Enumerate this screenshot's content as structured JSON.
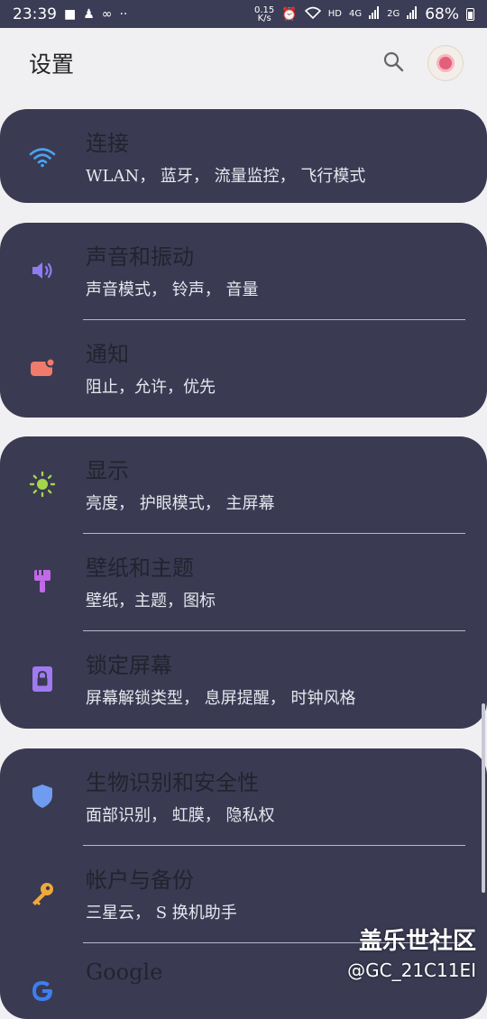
{
  "status_bar": {
    "time": "23:39",
    "speed_top": "0.15",
    "speed_bottom": "K/s",
    "hd": "HD",
    "net1": "4G",
    "net2": "2G",
    "battery": "68%"
  },
  "header": {
    "title": "设置"
  },
  "groups": [
    {
      "items": [
        {
          "title": "连接",
          "subtitle": "WLAN， 蓝牙， 流量监控， 飞行模式",
          "icon": "wifi-icon",
          "color": "#4aa3f0"
        }
      ]
    },
    {
      "items": [
        {
          "title": "声音和振动",
          "subtitle": "声音模式， 铃声， 音量",
          "icon": "volume-icon",
          "color": "#8f7cf0"
        },
        {
          "title": "通知",
          "subtitle": "阻止，允许，优先",
          "icon": "notification-icon",
          "color": "#f07a6b"
        }
      ]
    },
    {
      "items": [
        {
          "title": "显示",
          "subtitle": "亮度， 护眼模式， 主屏幕",
          "icon": "brightness-icon",
          "color": "#a4d64a"
        },
        {
          "title": "壁纸和主题",
          "subtitle": "壁纸，主题，图标",
          "icon": "brush-icon",
          "color": "#c06ae8"
        },
        {
          "title": "锁定屏幕",
          "subtitle": "屏幕解锁类型， 息屏提醒， 时钟风格",
          "icon": "lock-icon",
          "color": "#a07af0"
        }
      ]
    },
    {
      "items": [
        {
          "title": "生物识别和安全性",
          "subtitle": "面部识别， 虹膜， 隐私权",
          "icon": "shield-icon",
          "color": "#6f9cf0"
        },
        {
          "title": "帐户与备份",
          "subtitle": "三星云， S 换机助手",
          "icon": "key-icon",
          "color": "#f0a93a"
        },
        {
          "title": "Google",
          "subtitle": "",
          "icon": "google-icon",
          "color": "#3d7ff0"
        }
      ]
    }
  ],
  "watermark": {
    "line1": "盖乐世社区",
    "line2": "@GC_21C11EI"
  }
}
